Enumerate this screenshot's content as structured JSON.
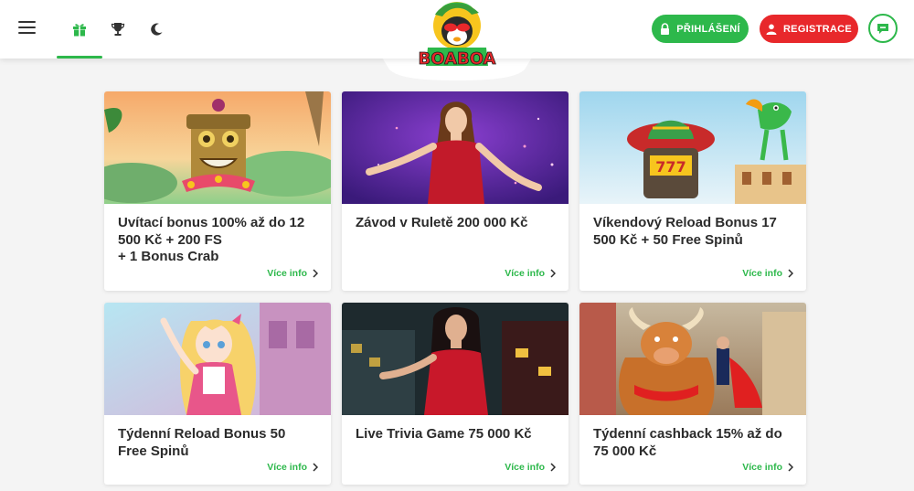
{
  "header": {
    "login_label": "PŘIHLÁŠENÍ",
    "register_label": "REGISTRACE",
    "logo_text": "BOABOA",
    "nav_icons": [
      "gift-icon",
      "trophy-icon",
      "moon-icon"
    ]
  },
  "colors": {
    "accent_green": "#2db84b",
    "accent_red": "#e8282b",
    "title_text": "#2b2b2b",
    "page_bg": "#f4f4f4"
  },
  "promotions": [
    {
      "title": "Uvítací bonus 100% až do 12 500 Kč + 200 FS\n+ 1 Bonus Crab",
      "link": "Více info"
    },
    {
      "title": "Závod v Ruletě 200 000 Kč",
      "link": "Více info"
    },
    {
      "title": "Víkendový Reload Bonus 17 500 Kč + 50 Free Spinů",
      "link": "Více info"
    },
    {
      "title": "Týdenní Reload Bonus 50 Free Spinů",
      "link": "Více info"
    },
    {
      "title": "Live Trivia Game 75 000 Kč",
      "link": "Více info"
    },
    {
      "title": "Týdenní cashback 15% až do 75 000 Kč",
      "link": "Více info"
    }
  ]
}
